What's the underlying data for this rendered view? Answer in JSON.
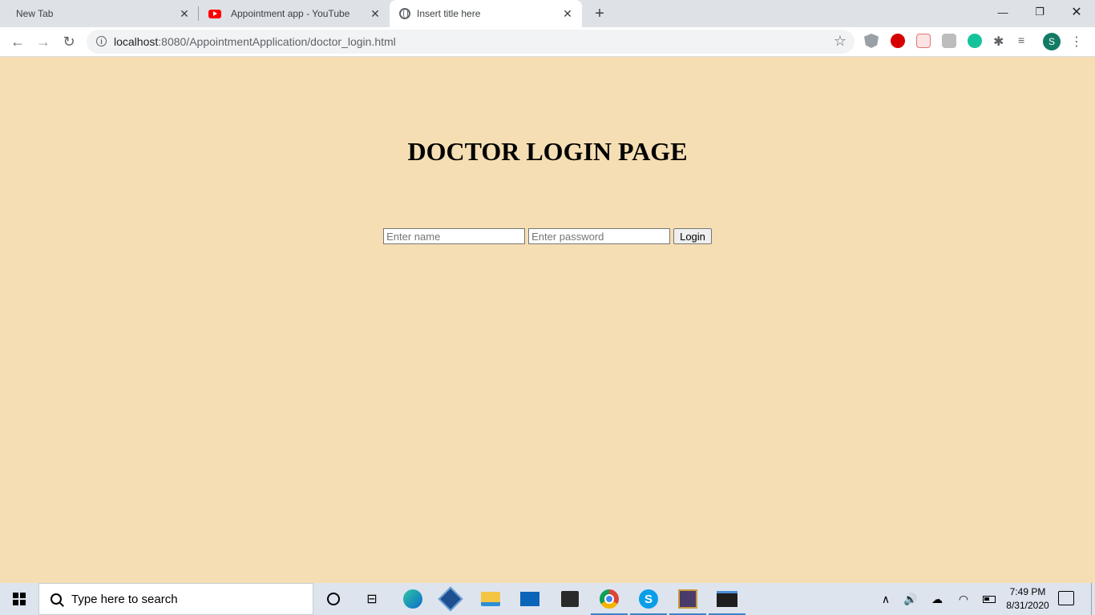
{
  "browser": {
    "tabs": [
      {
        "label": "New Tab",
        "active": false
      },
      {
        "label": "Appointment app - YouTube",
        "active": false,
        "icon": "youtube-icon"
      },
      {
        "label": "Insert title here",
        "active": true,
        "icon": "globe-icon"
      }
    ],
    "close_glyph": "✕",
    "new_tab_glyph": "+",
    "window_controls": {
      "minimize": "—",
      "restore": "❐",
      "close": "✕"
    },
    "nav": {
      "back": "←",
      "forward": "→",
      "reload": "↻"
    },
    "address": {
      "host": "localhost",
      "path": ":8080/AppointmentApplication/doctor_login.html"
    },
    "bookmark_star": "☆",
    "profile_initial": "S",
    "menu_glyph": "⋮",
    "extensions_glyph": "✱",
    "media_glyph": "≡"
  },
  "page": {
    "heading": "DOCTOR LOGIN PAGE",
    "background": "#f5deb3",
    "form": {
      "name_placeholder": "Enter name",
      "password_placeholder": "Enter password",
      "login_label": "Login"
    }
  },
  "taskbar": {
    "search_placeholder": "Type here to search",
    "task_view_glyph": "⊟",
    "skype_letter": "S",
    "tray": {
      "chevron": "∧",
      "volume": "🔊",
      "cloud": "☁",
      "wifi": "◠"
    },
    "clock": {
      "time": "7:49 PM",
      "date": "8/31/2020"
    }
  }
}
